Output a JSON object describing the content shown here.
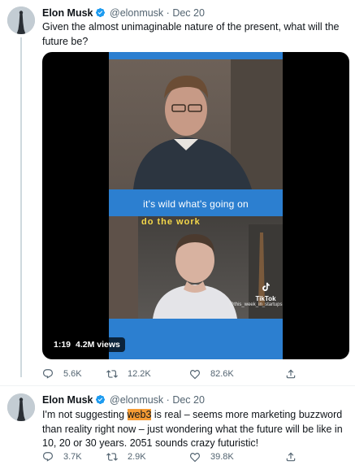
{
  "tweets": [
    {
      "author_name": "Elon Musk",
      "handle": "@elonmusk",
      "separator": "·",
      "date": "Dec 20",
      "text": "Given the almost unimaginable nature of the present, what will the future be?",
      "media": {
        "caption": "it's wild what's going on",
        "neon_sign": "do the work",
        "watermark": "TikTok",
        "watermark_user": "@this_week_in_startups",
        "duration": "1:19",
        "views": "4.2M views",
        "accent_color": "#2c7fd0"
      },
      "counts": {
        "replies": "5.6K",
        "retweets": "12.2K",
        "likes": "82.6K"
      }
    },
    {
      "author_name": "Elon Musk",
      "handle": "@elonmusk",
      "separator": "·",
      "date": "Dec 20",
      "text_before": "I'm not suggesting ",
      "text_highlight": "web3",
      "text_after": " is real – seems more marketing buzzword than reality right now – just wondering what the future will be like in 10, 20 or 30 years. 2051 sounds crazy futuristic!",
      "highlight_color": "#f59b34",
      "counts": {
        "replies": "3.7K",
        "retweets": "2.9K",
        "likes": "39.8K"
      }
    }
  ],
  "icons": [
    "verified-badge-icon",
    "reply-icon",
    "retweet-icon",
    "like-icon",
    "share-icon"
  ],
  "colors": {
    "verified": "#1d9bf0",
    "secondary_text": "#536471"
  }
}
